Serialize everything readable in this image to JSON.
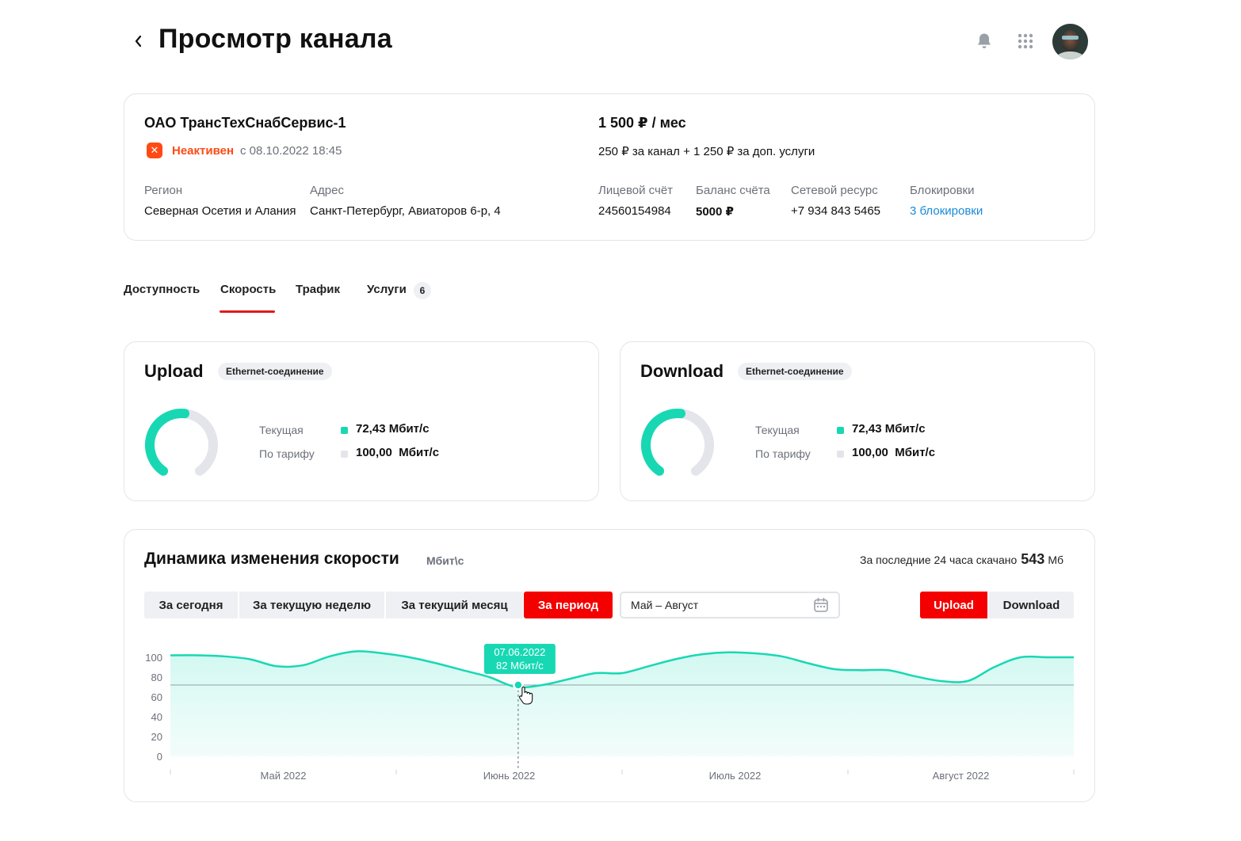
{
  "header": {
    "title": "Просмотр канала",
    "icons": [
      "chevron-left-icon",
      "bell-icon",
      "grid-icon"
    ]
  },
  "channel": {
    "company": "ОАО ТрансТехСнабСервис-1",
    "status": "Неактивен",
    "status_since": "с 08.10.2022 18:45",
    "status_color": "#ff4a14",
    "region_label": "Регион",
    "region_value": "Северная Осетия и Алания",
    "address_label": "Адрес",
    "address_value": "Санкт-Петербург, Авиаторов 6-р, 4",
    "price": "1 500 ₽ / мес",
    "price_breakdown": "250 ₽ за канал + 1 250 ₽ за доп. услуги",
    "account_label": "Лицевой счёт",
    "account_value": "24560154984",
    "balance_label": "Баланс счёта",
    "balance_value": "5000 ₽",
    "resource_label": "Сетевой ресурс",
    "resource_value": "+7 934 843 5465",
    "blocks_label": "Блокировки",
    "blocks_value": "3 блокировки"
  },
  "tabs": [
    {
      "label": "Доступность"
    },
    {
      "label": "Скорость"
    },
    {
      "label": "Трафик"
    },
    {
      "label": "Услуги",
      "badge": "6"
    }
  ],
  "active_tab": "Скорость",
  "upload": {
    "title": "Upload",
    "connection": "Ethernet-соединение",
    "current_label": "Текущая",
    "current_value": "72,43 Мбит/с",
    "tariff_label": "По тарифу",
    "tariff_value": "100,00  Мбит/с",
    "fill": 0.7243
  },
  "download": {
    "title": "Download",
    "connection": "Ethernet-соединение",
    "current_label": "Текущая",
    "current_value": "72,43 Мбит/с",
    "tariff_label": "По тарифу",
    "tariff_value": "100,00  Мбит/с",
    "fill": 0.7243
  },
  "dynamics": {
    "title": "Динамика изменения скорости",
    "unit": "Мбит\\с",
    "summary_prefix": "За последние 24 часа скачано",
    "summary_value": "543",
    "summary_unit": "Мб",
    "periods": [
      "За сегодня",
      "За текущую неделю",
      "За текущий месяц",
      "За период"
    ],
    "active_period": "За период",
    "date_range": "Май – Август",
    "direction": [
      "Upload",
      "Download"
    ],
    "active_direction": "Upload"
  },
  "colors": {
    "accent_red": "#f40000",
    "teal": "#18d8b4",
    "gauge_track": "#e3e5ea",
    "link_blue": "#1a8ad8"
  },
  "chart_data": {
    "type": "area",
    "y_ticks": [
      "100",
      "80",
      "60",
      "40",
      "20",
      "0"
    ],
    "ylim": [
      0,
      100
    ],
    "x_ticks": [
      "Май 2022",
      "Июнь 2022",
      "Июль 2022",
      "Август 2022"
    ],
    "threshold": 72,
    "tooltip": {
      "date": "07.06.2022",
      "value": "82 Мбит/с"
    },
    "series": [
      {
        "values": [
          102,
          102,
          101,
          98,
          91,
          92,
          101,
          106,
          104,
          100,
          94,
          87,
          80,
          70,
          72,
          78,
          84,
          84,
          91,
          98,
          103,
          105,
          104,
          101,
          94,
          88,
          87,
          87,
          81,
          76,
          76,
          90,
          100,
          100,
          100
        ]
      }
    ]
  }
}
